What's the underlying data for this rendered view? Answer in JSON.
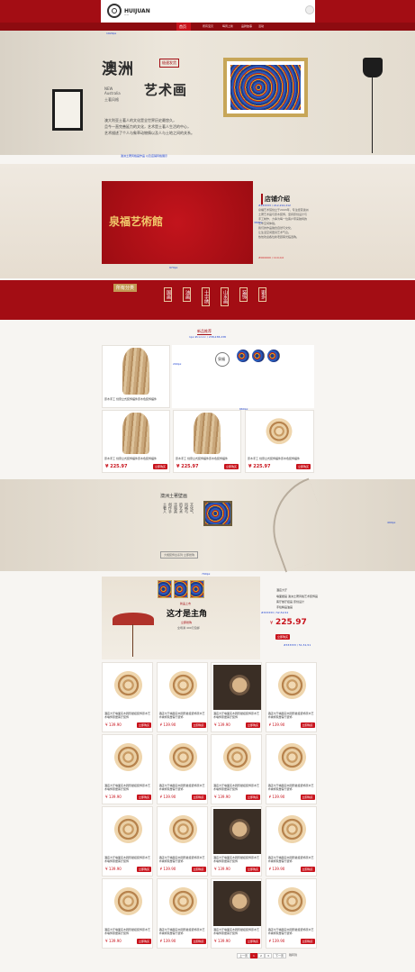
{
  "header": {
    "logo_text": "HUIJUAN",
    "tagline": "Ⅰ/Ⅱ/ⅡⅡ",
    "nav": [
      "首页",
      "所有宝贝",
      "每周上新",
      "品牌故事",
      "活动"
    ],
    "badge_text": "收藏"
  },
  "hero": {
    "title_1": "澳洲",
    "title_2": "艺术画",
    "badge": "极速发货",
    "en_1": "NEW",
    "en_2": "Australia",
    "cn_sub": "土著风格",
    "desc": [
      "澳大利亚土著人的文化是全世界历史最悠久，",
      "且今一直完善延力的文化，艺术是土著人生活的中心，",
      "艺术描述了个人与象草动物情以及人与土地之间的关系。"
    ],
    "size_note": "1920px",
    "caption": "澳洲土著风格画作品 以及店铺风格展示"
  },
  "shop_intro": {
    "banner_text": "泉福艺術館",
    "title": "店铺介绍",
    "body": [
      "泉福艺术馆创立于2003年，专注经营澳洲",
      "土著艺术画与原木装饰，坚持原创设计与",
      "手工制作，力争为每一位客户带来独特的",
      "艺术空间体验。",
      "我们的作品融合自然与文化，",
      "让生活空间更具艺术气息。",
      "热忱欢迎各位新老顾客光临选购。"
    ],
    "ann_1": "#333333 / 212,212,212",
    "ann_2": "#000000 / 110,0,0",
    "width_note": "970px",
    "height_note": "380px"
  },
  "category": {
    "label": "所有分类",
    "items": [
      "国画",
      "油画",
      "十字绣",
      "山水画",
      "装饰",
      "更多"
    ]
  },
  "featured": {
    "section_title": "新品推荐",
    "ann_color": "1px #cccccc / 238,238,238",
    "promo_logo": "泉福",
    "size_a": "290px",
    "size_b": "660px",
    "products": [
      {
        "name": "原木手工 创意立式装饰摆件原木色装饰摆件",
        "price": "¥ 225.97",
        "buy": "立即购买"
      },
      {
        "name": "原木手工 创意立式装饰摆件原木色装饰摆件",
        "price": "¥ 225.97",
        "buy": "立即购买"
      },
      {
        "name": "原木手工 创意立式装饰摆件原木色装饰摆件",
        "price": "¥ 225.97",
        "buy": "立即购买"
      }
    ]
  },
  "culture": {
    "title": "澳洲土著壁画",
    "text": [
      "土著人",
      "创作手",
      "法独具",
      "的艺术",
      "风格与",
      "文化气"
    ],
    "button": "大幅装饰全系列 立即抢购",
    "side_note": "490px"
  },
  "main_promo": {
    "line_1": "新品上市",
    "line_2": "这才是主角",
    "line_3": "立即抢购",
    "line_4": "全场满 499元包邮",
    "width_note": "790px",
    "side_title": "酒店大厅",
    "side_desc": [
      "墙面壁画 澳洲土著风格艺术装饰画",
      "客厅餐厅挂画 原创设计",
      "手绘精品油画"
    ],
    "price": "225.97",
    "currency": "¥",
    "buy": "立即购买",
    "ann_1": "#333333 / 52,52,52",
    "ann_2": "#333333 / 51,51,51"
  },
  "grid": {
    "product_name": "酒店大厅墙面实木圆形壁挂装饰原木艺术墙饰家居客厅装饰",
    "price": "¥ 139.90",
    "buy": "立即购买",
    "rows": 4,
    "cols": 4,
    "row_images": [
      [
        "rings",
        "rings",
        "dark",
        "rings"
      ],
      [
        "rings",
        "rings",
        "rings",
        "rings"
      ],
      [
        "rings",
        "rings",
        "dark",
        "rings"
      ],
      [
        "rings",
        "rings",
        "dark",
        "rings"
      ]
    ]
  },
  "pagination": {
    "prev": "上一页",
    "pages": [
      "1",
      "2",
      "3"
    ],
    "next": "下一页",
    "jump": "跳转到"
  },
  "colors": {
    "brand_red": "#a30d14",
    "button_red": "#c8121b",
    "annotation_blue": "#1a3fd0"
  }
}
